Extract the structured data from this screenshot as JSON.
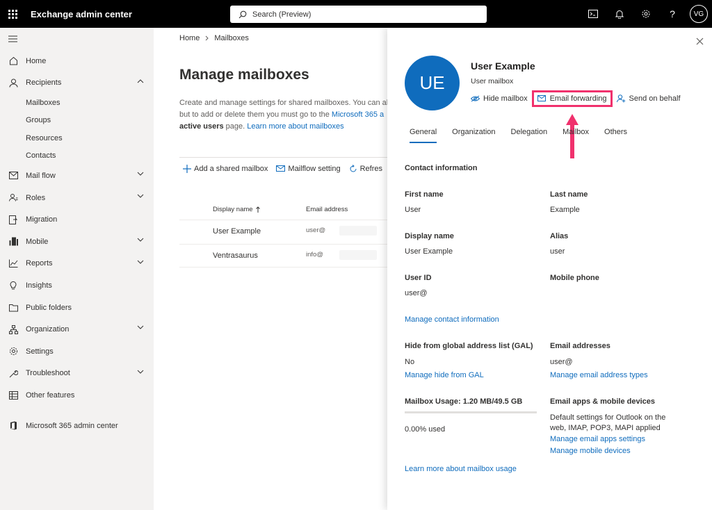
{
  "topbar": {
    "app_title": "Exchange admin center",
    "search_placeholder": "Search (Preview)",
    "user_initials": "VG"
  },
  "sidebar": {
    "items": [
      {
        "label": "Home",
        "icon": "home-icon"
      },
      {
        "label": "Recipients",
        "icon": "person-icon"
      },
      {
        "label": "Mailboxes"
      },
      {
        "label": "Groups"
      },
      {
        "label": "Resources"
      },
      {
        "label": "Contacts"
      },
      {
        "label": "Mail flow",
        "icon": "mail-icon"
      },
      {
        "label": "Roles",
        "icon": "roles-icon"
      },
      {
        "label": "Migration",
        "icon": "migration-icon"
      },
      {
        "label": "Mobile",
        "icon": "mobile-icon"
      },
      {
        "label": "Reports",
        "icon": "reports-icon"
      },
      {
        "label": "Insights",
        "icon": "insights-icon"
      },
      {
        "label": "Public folders",
        "icon": "folder-icon"
      },
      {
        "label": "Organization",
        "icon": "organization-icon"
      },
      {
        "label": "Settings",
        "icon": "gear-icon"
      },
      {
        "label": "Troubleshoot",
        "icon": "wrench-icon"
      },
      {
        "label": "Other features",
        "icon": "table-icon"
      },
      {
        "label": "Microsoft 365 admin center",
        "icon": "office-icon"
      }
    ]
  },
  "main": {
    "breadcrumb": [
      "Home",
      "Mailboxes"
    ],
    "title": "Manage mailboxes",
    "desc_line1": "Create and manage settings for shared mailboxes. You can als",
    "desc_line2a": "but to add or delete them you must go to the ",
    "desc_line2_link": "Microsoft 365 a",
    "desc_line3_bold": "active users",
    "desc_line3": " page. ",
    "desc_line3_link": "Learn more about mailboxes",
    "toolbar": {
      "add": "Add a shared mailbox",
      "mailflow": "Mailflow setting",
      "refresh": "Refres"
    },
    "table": {
      "col_name": "Display name",
      "col_email": "Email address",
      "rows": [
        {
          "name": "User Example",
          "email": "user@"
        },
        {
          "name": "Ventrasaurus",
          "email": "info@"
        }
      ]
    }
  },
  "panel": {
    "initials": "UE",
    "name": "User Example",
    "type": "User mailbox",
    "actions": {
      "hide": "Hide mailbox",
      "forwarding": "Email forwarding",
      "send_on_behalf": "Send on behalf"
    },
    "tabs": [
      "General",
      "Organization",
      "Delegation",
      "Mailbox",
      "Others"
    ],
    "contact_title": "Contact information",
    "first_name_label": "First name",
    "first_name": "User",
    "last_name_label": "Last name",
    "last_name": "Example",
    "display_name_label": "Display name",
    "display_name": "User Example",
    "alias_label": "Alias",
    "alias": "user",
    "user_id_label": "User ID",
    "user_id": "user@",
    "mobile_label": "Mobile phone",
    "manage_contact": "Manage contact information",
    "gal_label": "Hide from global address list (GAL)",
    "gal_value": "No",
    "manage_gal": "Manage hide from GAL",
    "email_addresses_label": "Email addresses",
    "email_addresses": "user@",
    "manage_email_types": "Manage email address types",
    "usage_label": "Mailbox Usage: 1.20 MB/49.5 GB",
    "usage_fraction": 0.0,
    "usage_used": "0.00% used",
    "apps_label": "Email apps & mobile devices",
    "apps_desc1": "Default settings for Outlook on the",
    "apps_desc2": "web, IMAP, POP3, MAPI applied",
    "manage_apps": "Manage email apps settings",
    "manage_mobile": "Manage mobile devices",
    "learn_usage": "Learn more about mailbox usage"
  },
  "colors": {
    "accent": "#0f6cbd",
    "highlight": "#f0316d"
  }
}
